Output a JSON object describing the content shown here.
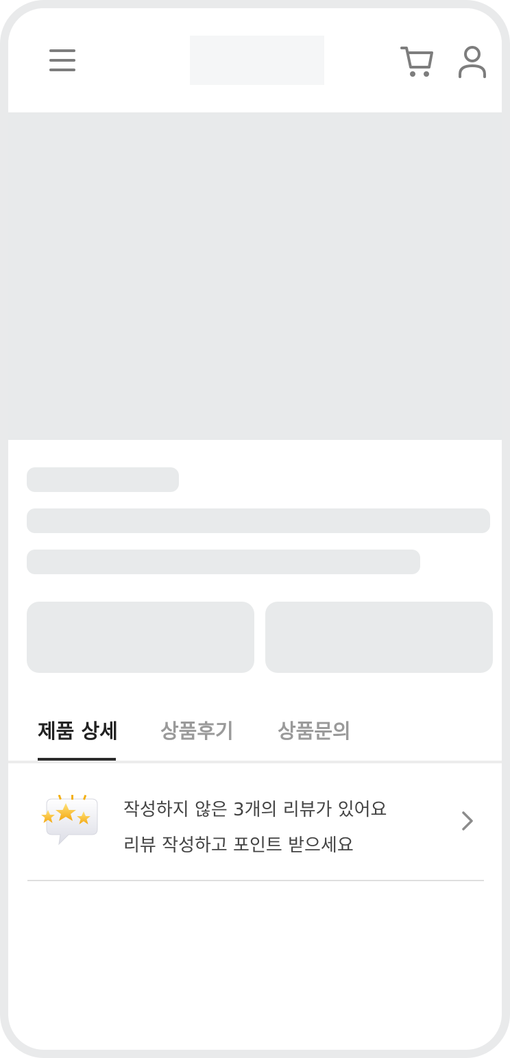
{
  "tabs": [
    {
      "label": "제품 상세",
      "active": true
    },
    {
      "label": "상품후기",
      "active": false
    },
    {
      "label": "상품문의",
      "active": false
    }
  ],
  "review_banner": {
    "line1": "작성하지 않은 3개의 리뷰가 있어요",
    "line2": "리뷰 작성하고 포인트 받으세요"
  },
  "icons": {
    "menu": "hamburger-menu-icon",
    "cart": "cart-icon",
    "user": "user-icon",
    "review": "review-stars-speech-bubble-icon",
    "chevron": "chevron-right-icon"
  },
  "colors": {
    "placeholder": "#e8eaeb",
    "active_tab": "#222222",
    "inactive_tab": "#9a9a9a",
    "icon_gray": "#7d7d7d"
  }
}
